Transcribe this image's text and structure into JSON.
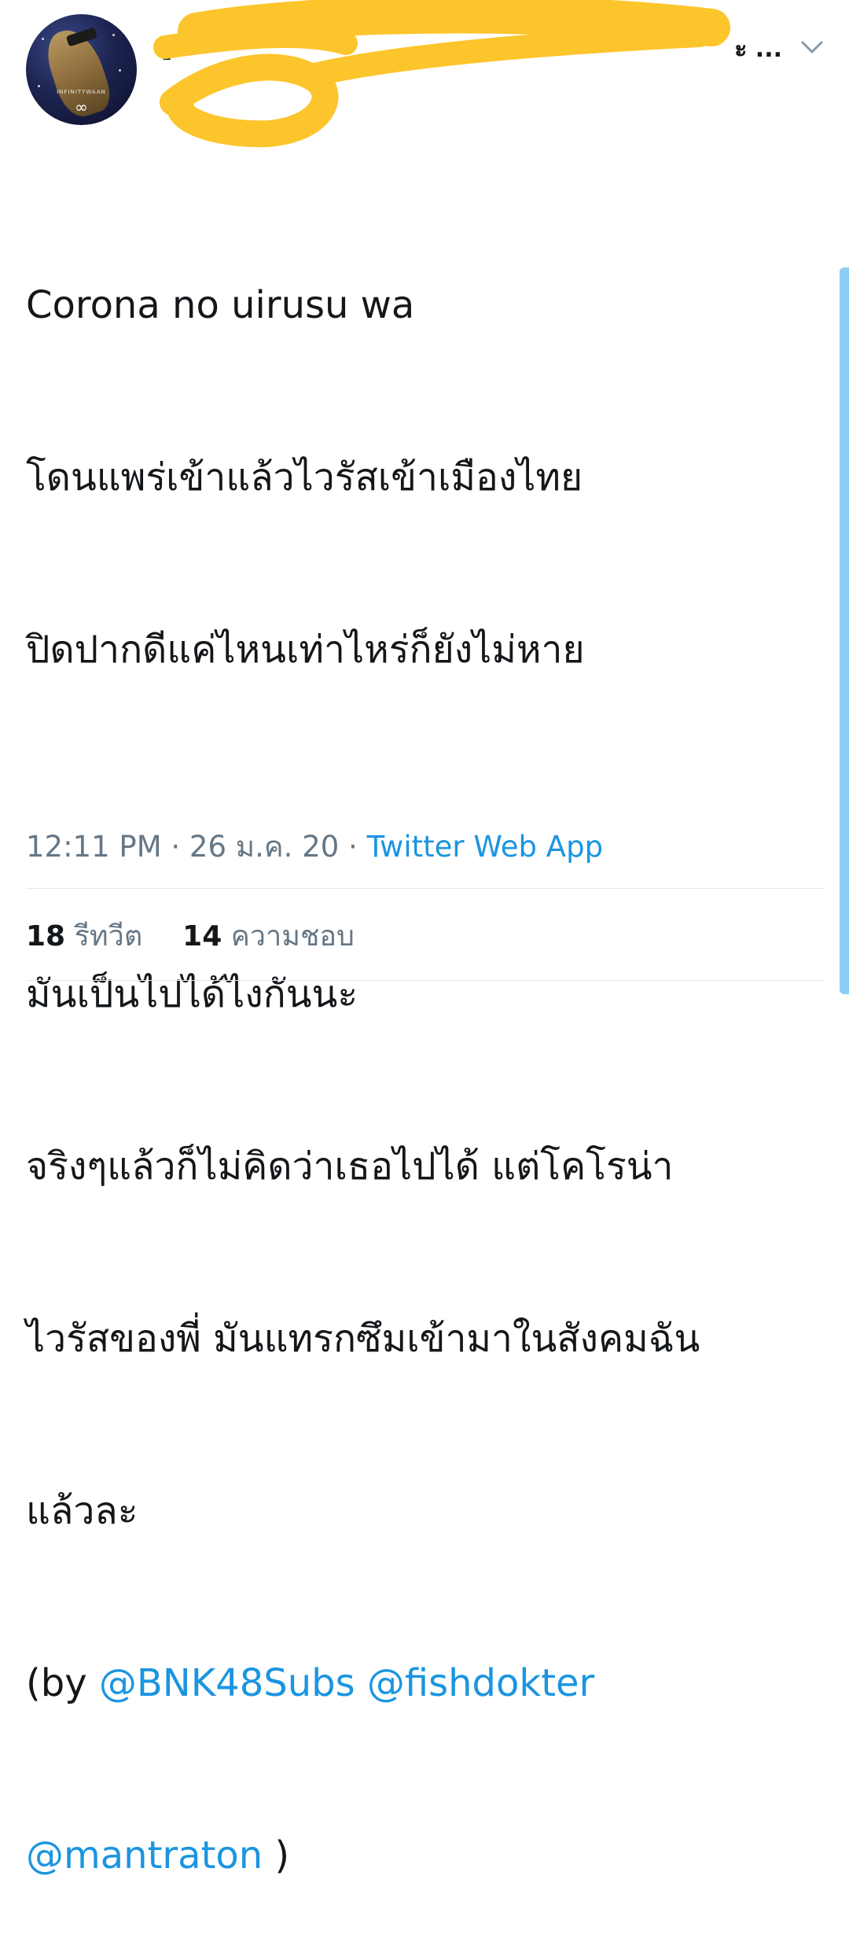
{
  "tweet": {
    "author": {
      "name_visible_prefix": "[",
      "name_visible_suffix": "ะ ...",
      "avatar_watermark": "INFINITYWAAN",
      "avatar_symbol": "∞"
    },
    "text_lines": [
      "Corona no uirusu wa",
      "โดนแพร่เข้าแล้วไวรัสเข้าเมืองไทย",
      "ปิดปากดีแค่ไหนเท่าไหร่ก็ยังไม่หาย",
      "",
      "มันเป็นไปได้ไงกันนะ",
      "จริงๆแล้วก็ไม่คิดว่าเธอไปได้ แต่โคโรน่า",
      "ไวรัสของพี่ มันแทรกซึมเข้ามาในสังคมฉัน",
      "แล้วละ"
    ],
    "credit": {
      "prefix": "(by ",
      "mentions": [
        "@BNK48Subs",
        "@fishdokter",
        "@mantraton"
      ],
      "suffix": " )"
    },
    "meta": {
      "time": "12:11 PM",
      "date": "26 ม.ค. 20",
      "source": "Twitter Web App",
      "separator": " · "
    },
    "stats": {
      "retweets_count": "18",
      "retweets_label": "รีทวีต",
      "likes_count": "14",
      "likes_label": "ความชอบ"
    }
  },
  "colors": {
    "link": "#1b95e0",
    "secondary_text": "#657786",
    "primary_text": "#14171a",
    "redaction": "#fdc52c",
    "scrollbar": "#8ecdf3",
    "divider": "#e1e8ed"
  },
  "icons": {
    "menu": "chevron-down-icon"
  }
}
